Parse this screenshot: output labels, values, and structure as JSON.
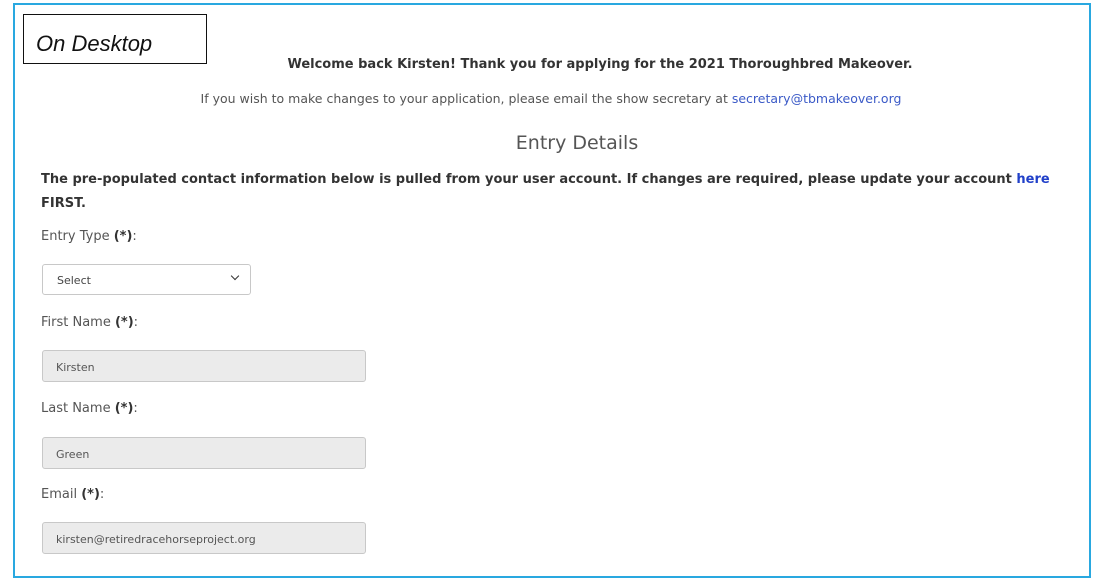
{
  "callout": "On Desktop",
  "welcome": "Welcome back Kirsten! Thank you for applying for the 2021 Thoroughbred Makeover.",
  "changes": {
    "text": "If you wish to make changes to your application, please email the show secretary at ",
    "email": "secretary@tbmakeover.org"
  },
  "section_title": "Entry Details",
  "prepop": {
    "text": "The pre-populated contact information below is pulled from your user account. If changes are required, please update your account ",
    "link": "here",
    "suffix": "FIRST."
  },
  "required_marker": "(*)",
  "fields": {
    "entry_type": {
      "label": "Entry Type ",
      "value": "Select"
    },
    "first_name": {
      "label": "First Name ",
      "value": "Kirsten"
    },
    "last_name": {
      "label": "Last Name ",
      "value": "Green"
    },
    "email": {
      "label": "Email ",
      "value": "kirsten@retiredracehorseproject.org"
    }
  },
  "colors": {
    "frame": "#29a8e0",
    "link": "#3b5ac7"
  }
}
